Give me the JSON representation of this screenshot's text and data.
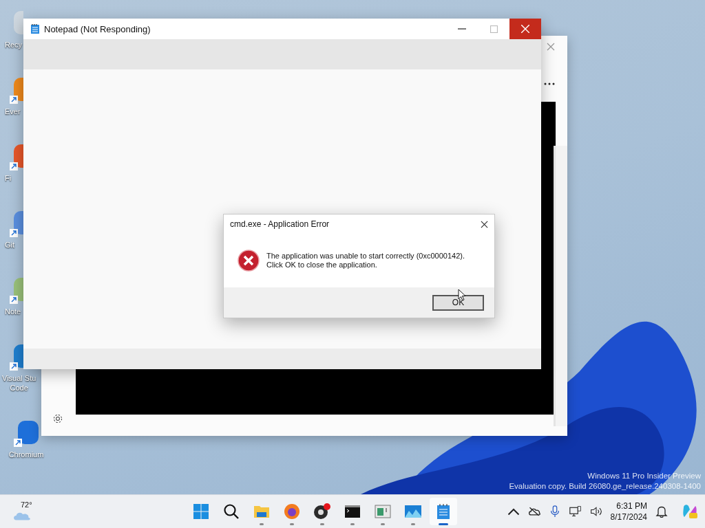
{
  "desktop_icons": [
    {
      "kind": "recycle",
      "label": "Recy",
      "shortcut": false
    },
    {
      "kind": "evernote",
      "label": "Ever",
      "shortcut": true
    },
    {
      "kind": "firefox",
      "label": "Fi",
      "shortcut": true
    },
    {
      "kind": "git",
      "label": "Git",
      "shortcut": true
    },
    {
      "kind": "notepadpp",
      "label": "Note",
      "shortcut": true
    },
    {
      "kind": "vscode",
      "label": "Visual Stu\nCode",
      "shortcut": true
    },
    {
      "kind": "chromium",
      "label": "Chromium",
      "shortcut": true
    }
  ],
  "notepad": {
    "title": "Notepad (Not Responding)"
  },
  "dialog": {
    "title": "cmd.exe - Application Error",
    "message": [
      "The application was unable to start correctly (0xc0000142).",
      "Click OK to close the application."
    ],
    "button": "OK"
  },
  "watermark": [
    "Windows 11 Pro Insider Preview",
    "Evaluation copy. Build 26080.ge_release.240308-1400"
  ],
  "taskbar": {
    "weather": "72°",
    "apps": [
      {
        "kind": "start",
        "running": false,
        "selected": false
      },
      {
        "kind": "search",
        "running": false,
        "selected": false
      },
      {
        "kind": "explorer",
        "running": true,
        "selected": false
      },
      {
        "kind": "firefox",
        "running": true,
        "selected": false
      },
      {
        "kind": "obs",
        "running": true,
        "selected": false
      },
      {
        "kind": "terminal",
        "running": true,
        "selected": false
      },
      {
        "kind": "app",
        "running": true,
        "selected": false
      },
      {
        "kind": "photos",
        "running": true,
        "selected": false
      },
      {
        "kind": "notepad",
        "running": true,
        "selected": true
      }
    ],
    "time": "6:31 PM",
    "date": "8/17/2024"
  }
}
